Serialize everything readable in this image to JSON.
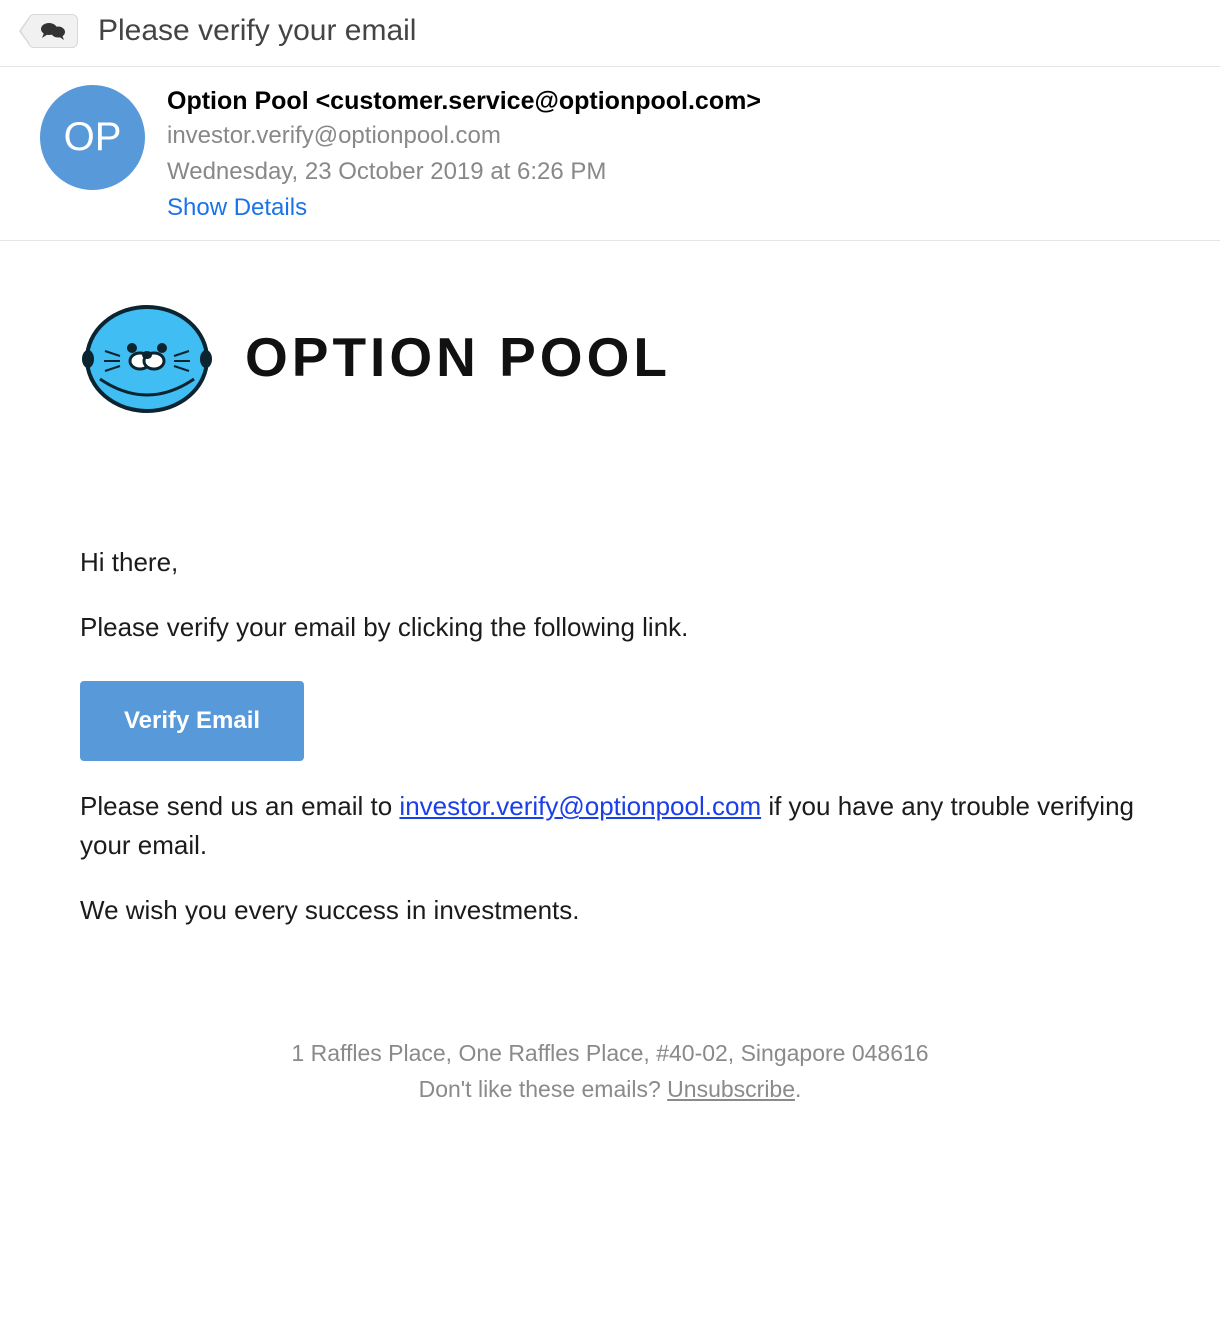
{
  "subject": "Please verify your email",
  "header": {
    "avatar_initials": "OP",
    "from": "Option Pool <customer.service@optionpool.com>",
    "to": "investor.verify@optionpool.com",
    "date": "Wednesday, 23 October 2019 at 6:26 PM",
    "show_details_label": "Show Details"
  },
  "brand": {
    "name": "OPTION POOL"
  },
  "body": {
    "greeting": "Hi there,",
    "instruction": "Please verify your email by clicking the following link.",
    "verify_button_label": "Verify Email",
    "support_prefix": "Please send us an email to ",
    "support_email": "investor.verify@optionpool.com",
    "support_suffix": " if you have any trouble verifying your email.",
    "closing": "We wish you every success in investments."
  },
  "footer": {
    "address": "1 Raffles Place, One Raffles Place, #40-02, Singapore 048616",
    "unsubscribe_prefix": "Don't like these emails? ",
    "unsubscribe_label": "Unsubscribe",
    "unsubscribe_suffix": "."
  }
}
